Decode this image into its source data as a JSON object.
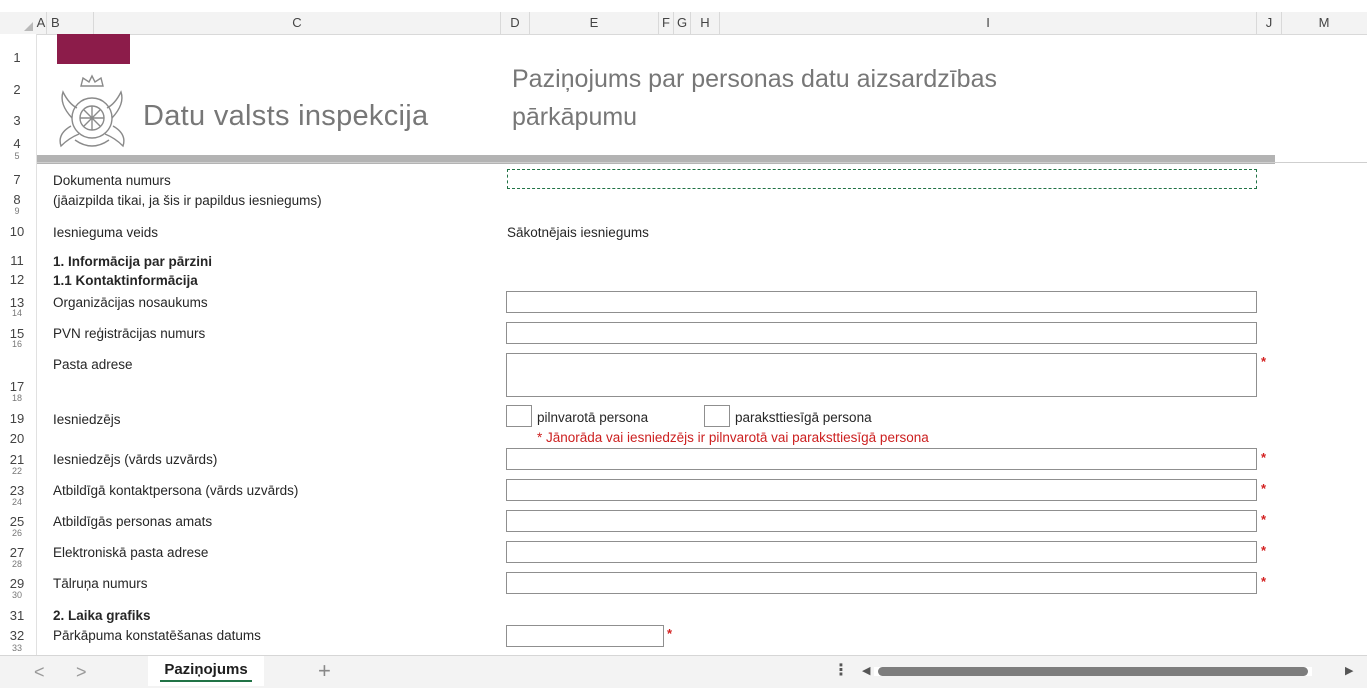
{
  "columns": [
    "A",
    "B",
    "C",
    "D",
    "E",
    "F",
    "G",
    "H",
    "I",
    "J",
    "M"
  ],
  "rows": {
    "major": [
      "1",
      "2",
      "3",
      "4",
      "7",
      "8",
      "10",
      "11",
      "12",
      "13",
      "15",
      "17",
      "19",
      "20",
      "21",
      "23",
      "25",
      "27",
      "29",
      "31",
      "32"
    ],
    "minor": [
      "5",
      "9",
      "14",
      "16",
      "18",
      "22",
      "24",
      "26",
      "28",
      "30",
      "33"
    ]
  },
  "header": {
    "org_name": "Datu valsts inspekcija",
    "title_line1": "Paziņojums par personas datu aizsardzības",
    "title_line2": "pārkāpumu"
  },
  "form": {
    "doc_number_label": "Dokumenta numurs",
    "doc_number_hint": "(jāaizpilda tikai, ja šis ir papildus iesniegums)",
    "submission_type_label": "Iesnieguma veids",
    "submission_type_value": "Sākotnējais iesniegums",
    "section1_title": "1. Informācija par pārzini",
    "section11_title": "1.1 Kontaktinformācija",
    "org_name_label": "Organizācijas nosaukums",
    "vat_label": "PVN reģistrācijas numurs",
    "postal_label": "Pasta adrese",
    "submitter_label": "Iesniedzējs",
    "option_authorized": "pilnvarotā persona",
    "option_signatory": "paraksttiesīgā persona",
    "submitter_warning": "* Jānorāda vai iesniedzējs ir pilnvarotā vai paraksttiesīgā persona",
    "submitter_name_label": "Iesniedzējs (vārds uzvārds)",
    "contact_person_label": "Atbildīgā kontaktpersona (vārds uzvārds)",
    "position_label": "Atbildīgās personas amats",
    "email_label": "Elektroniskā pasta adrese",
    "phone_label": "Tālruņa numurs",
    "section2_title": "2. Laika grafiks",
    "detection_date_label": "Pārkāpuma konstatēšanas datums",
    "required_mark": "*"
  },
  "tabs": {
    "active_sheet": "Paziņojums",
    "prev_label": "<",
    "next_label": ">",
    "add_label": "+",
    "more_label": "⋮"
  },
  "colors": {
    "brand_bar": "#8c1c4a",
    "required": "#d32020",
    "selection": "#217346"
  }
}
